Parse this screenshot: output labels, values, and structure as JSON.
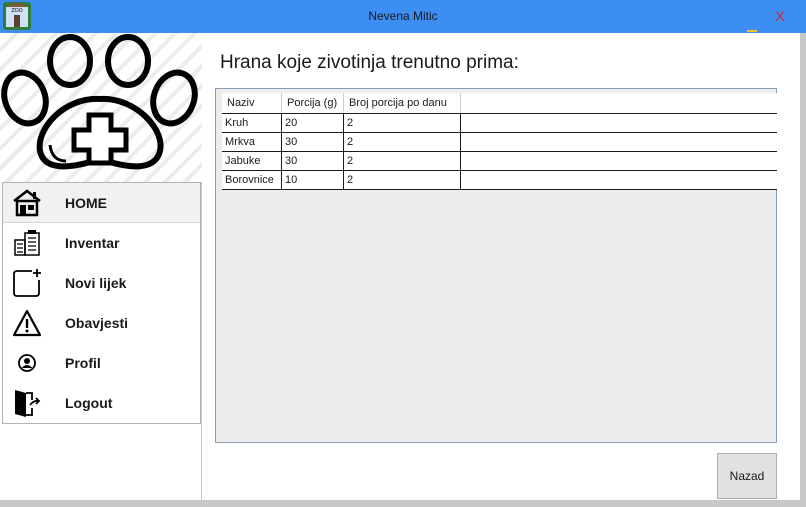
{
  "window": {
    "title": "Nevena Mitic",
    "close_label": "X"
  },
  "sidebar": {
    "items": [
      {
        "label": "HOME",
        "icon": "home-icon"
      },
      {
        "label": "Inventar",
        "icon": "inventory-icon"
      },
      {
        "label": "Novi lijek",
        "icon": "add-new-icon"
      },
      {
        "label": "Obavjesti",
        "icon": "warning-icon"
      },
      {
        "label": "Profil",
        "icon": "user-icon"
      },
      {
        "label": "Logout",
        "icon": "logout-icon"
      }
    ]
  },
  "main": {
    "heading": "Hrana koje zivotinja trenutno  prima:",
    "table": {
      "columns": [
        "Naziv",
        "Porcija (g)",
        "Broj porcija po danu",
        ""
      ],
      "rows": [
        [
          "Kruh",
          "20",
          "2",
          ""
        ],
        [
          "Mrkva",
          "30",
          "2",
          ""
        ],
        [
          "Jabuke",
          "30",
          "2",
          ""
        ],
        [
          "Borovnice",
          "10",
          "2",
          ""
        ]
      ]
    },
    "back_button": "Nazad"
  },
  "colors": {
    "titlebar": "#3d8ef2",
    "close": "#e0202a"
  }
}
